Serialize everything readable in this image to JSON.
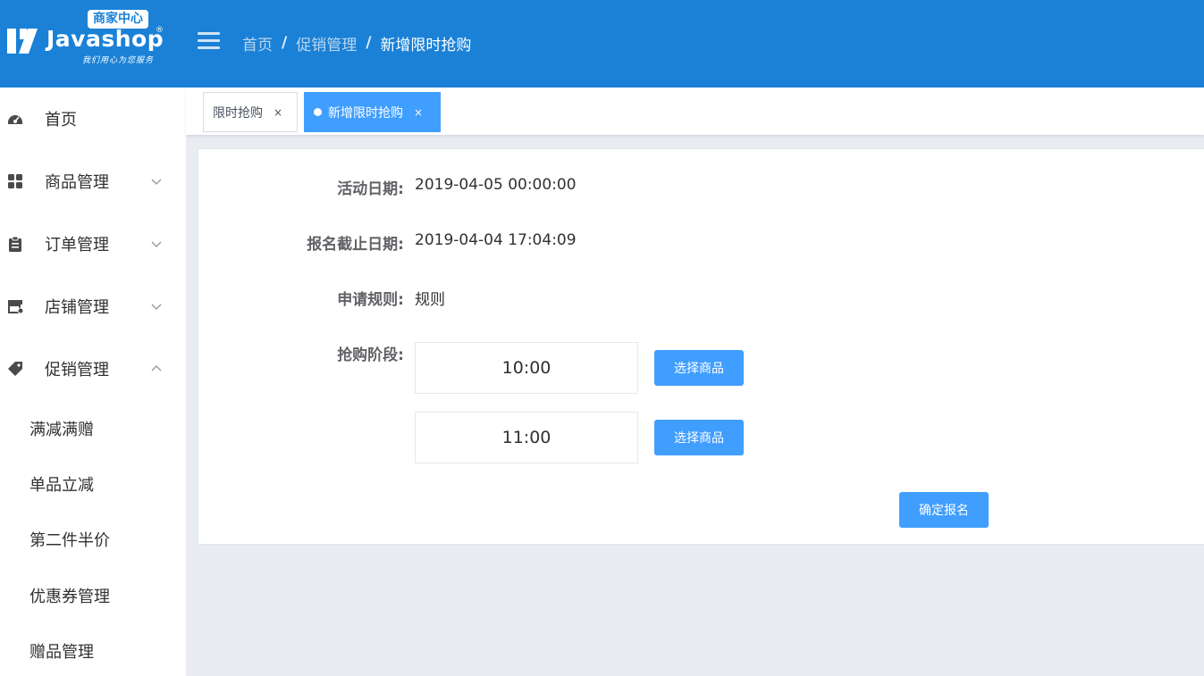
{
  "header": {
    "badge": "商家中心",
    "brand": "Javashop",
    "registered": "®",
    "slogan": "我们用心为您服务",
    "breadcrumb": [
      "首页",
      "促销管理",
      "新增限时抢购"
    ],
    "separator": "/",
    "bg_color": "#1a81d7"
  },
  "sidebar": {
    "items": [
      {
        "label": "首页",
        "icon": "dashboard-icon"
      },
      {
        "label": "商品管理",
        "icon": "goods-icon",
        "expanded": false
      },
      {
        "label": "订单管理",
        "icon": "clipboard-icon",
        "expanded": false
      },
      {
        "label": "店铺管理",
        "icon": "shop-icon",
        "expanded": false
      },
      {
        "label": "促销管理",
        "icon": "tag-icon",
        "expanded": true
      }
    ],
    "sub_items": [
      "满减满赠",
      "单品立减",
      "第二件半价",
      "优惠券管理",
      "赠品管理"
    ]
  },
  "tags": [
    {
      "label": "限时抢购",
      "active": false,
      "close": "×"
    },
    {
      "label": "新增限时抢购",
      "active": true,
      "close": "×"
    }
  ],
  "form": {
    "activity_date_label": "活动日期:",
    "activity_date": "2019-04-05 00:00:00",
    "deadline_label": "报名截止日期:",
    "deadline": "2019-04-04 17:04:09",
    "rules_label": "申请规则:",
    "rules": "规则",
    "stages_label": "抢购阶段:",
    "stages": [
      {
        "time": "10:00",
        "button": "选择商品"
      },
      {
        "time": "11:00",
        "button": "选择商品"
      }
    ],
    "confirm_button": "确定报名"
  },
  "colors": {
    "primary": "#409eff",
    "header": "#1a81d7"
  }
}
